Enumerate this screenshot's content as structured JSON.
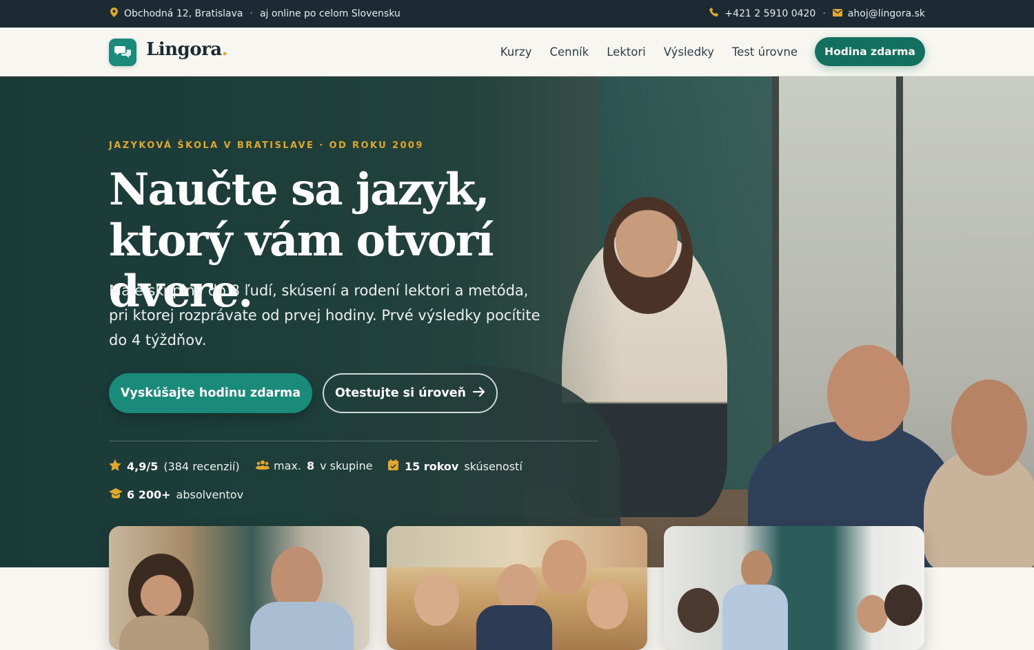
{
  "topbar": {
    "address": "Obchodná 12, Bratislava",
    "separator": "·",
    "online": "aj online po celom Slovensku",
    "phone": "+421 2 5910 0420",
    "email": "ahoj@lingora.sk"
  },
  "nav": {
    "logo": "Lingora",
    "logo_dot": ".",
    "items": [
      "Kurzy",
      "Cenník",
      "Lektori",
      "Výsledky",
      "Test úrovne"
    ],
    "cta": "Hodina zdarma"
  },
  "hero": {
    "eyebrow": "JAZYKOVÁ ŠKOLA V BRATISLAVE · OD ROKU 2009",
    "title_line1": "Naučte sa jazyk,",
    "title_line2": "ktorý vám otvorí dvere.",
    "lead": "Malé skupiny do 8 ľudí, skúsení a rodení lektori a metóda, pri ktorej rozprávate od prvej hodiny. Prvé výsledky pocítite do 4 týždňov.",
    "primary_button": "Vyskúšajte hodinu zdarma",
    "secondary_button": "Otestujte si úroveň",
    "stats": {
      "rating_value": "4,9/5",
      "rating_reviews": "(384 recenzií)",
      "group_prefix": "max.",
      "group_value": "8",
      "group_suffix": "v skupine",
      "years_value": "15 rokov",
      "years_suffix": "skúseností",
      "grads_value": "6 200+",
      "grads_suffix": "absolventov"
    }
  },
  "colors": {
    "accent": "#1a8a7a",
    "accent_dark": "#13705f",
    "gold": "#e0a72c",
    "topbar_bg": "#1b2a33"
  },
  "icons": {
    "address": "map-pin-icon",
    "phone": "phone-icon",
    "email": "envelope-icon",
    "logo": "chat-bubbles-icon",
    "arrow": "arrow-right-icon",
    "rating": "star-icon",
    "group": "users-icon",
    "years": "calendar-icon",
    "grads": "graduation-cap-icon"
  }
}
